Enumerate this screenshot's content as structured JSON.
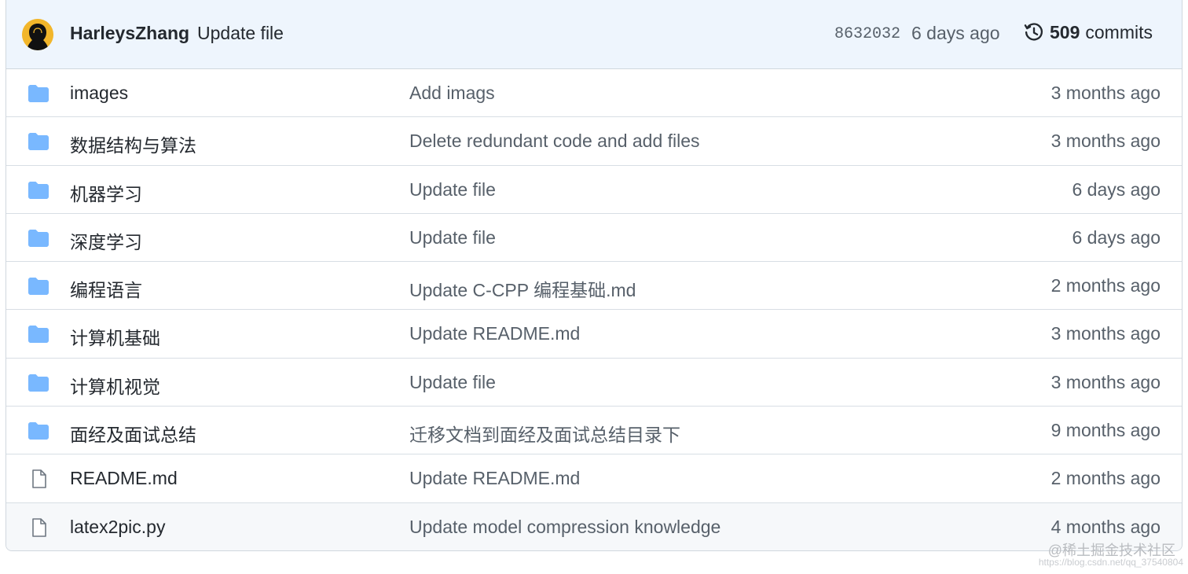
{
  "latest_commit": {
    "author": "HarleysZhang",
    "message": "Update file",
    "sha": "8632032",
    "age": "6 days ago",
    "commits_count": "509",
    "commits_label": "commits"
  },
  "files": [
    {
      "name": "images",
      "type": "folder",
      "message": "Add imags",
      "age": "3 months ago"
    },
    {
      "name": "数据结构与算法",
      "type": "folder",
      "message": "Delete redundant code and add files",
      "age": "3 months ago"
    },
    {
      "name": "机器学习",
      "type": "folder",
      "message": "Update file",
      "age": "6 days ago"
    },
    {
      "name": "深度学习",
      "type": "folder",
      "message": "Update file",
      "age": "6 days ago"
    },
    {
      "name": "编程语言",
      "type": "folder",
      "message": "Update C-CPP 编程基础.md",
      "age": "2 months ago"
    },
    {
      "name": "计算机基础",
      "type": "folder",
      "message": "Update README.md",
      "age": "3 months ago"
    },
    {
      "name": "计算机视觉",
      "type": "folder",
      "message": "Update file",
      "age": "3 months ago"
    },
    {
      "name": "面经及面试总结",
      "type": "folder",
      "message": "迁移文档到面经及面试总结目录下",
      "age": "9 months ago"
    },
    {
      "name": "README.md",
      "type": "file",
      "message": "Update README.md",
      "age": "2 months ago"
    },
    {
      "name": "latex2pic.py",
      "type": "file",
      "message": "Update model compression knowledge",
      "age": "4 months ago"
    }
  ],
  "icons": {
    "folder": "folder-icon",
    "file": "file-icon",
    "history": "history-icon"
  },
  "colors": {
    "folder": "#79b8ff",
    "header_bg": "#eef5fd",
    "avatar_bg": "#f2b62b"
  },
  "watermark": {
    "text": "@稀土掘金技术社区",
    "url": "https://blog.csdn.net/qq_37540804"
  }
}
